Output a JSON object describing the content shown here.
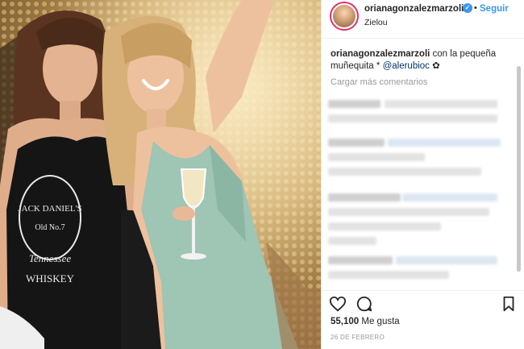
{
  "post": {
    "photo_alt": "",
    "header": {
      "username": "orianagonzalezmarzoli",
      "verified_glyph": "✓",
      "separator": "•",
      "follow_label": "Seguir",
      "location": "Zielou"
    },
    "caption": {
      "username": "orianagonzalezmarzoli",
      "text": " con la pequeña muñequita * ",
      "mention": "@alerubioc",
      "emoji": "✿"
    },
    "load_more_label": "Cargar más comentarios",
    "actions": {
      "like_icon": "heart-icon",
      "comment_icon": "comment-icon",
      "save_icon": "bookmark-icon"
    },
    "likes": {
      "count": "55,100",
      "label": " Me gusta"
    },
    "date": "26 DE FEBRERO"
  },
  "colors": {
    "link_blue": "#3897f0",
    "text": "#262626",
    "muted": "#999999",
    "mention": "#003569",
    "ring": "#e1306c"
  }
}
